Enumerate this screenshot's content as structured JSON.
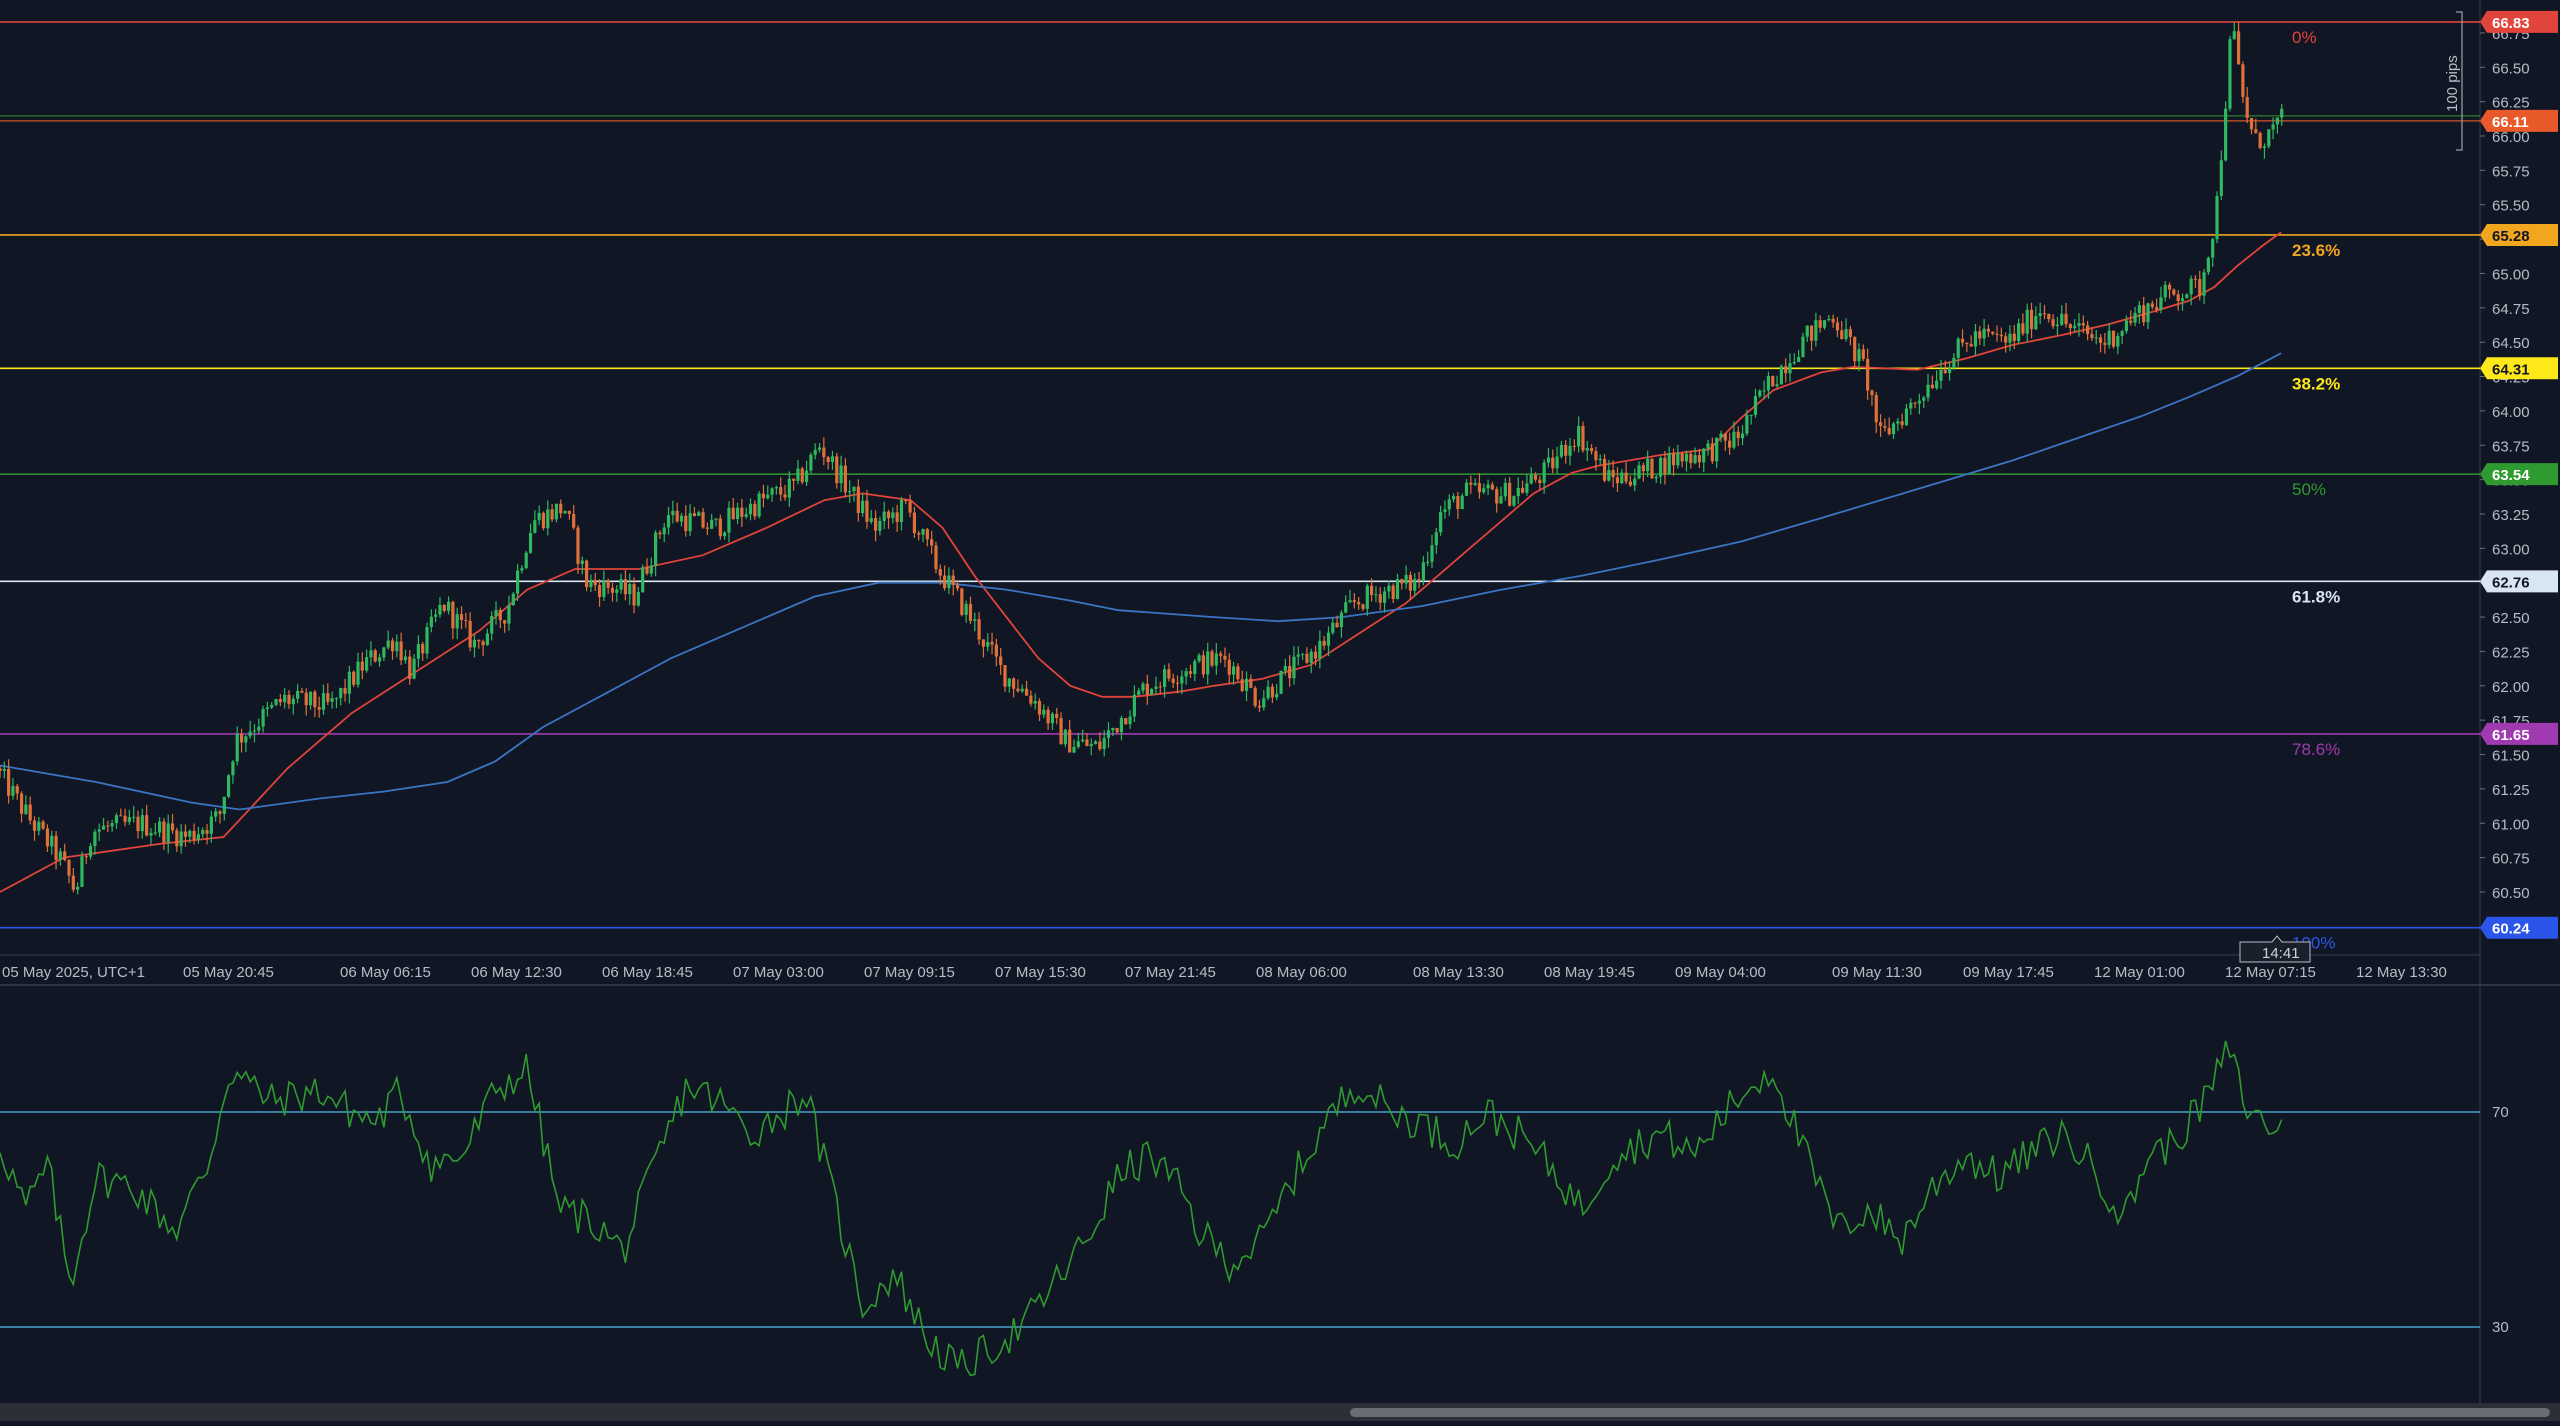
{
  "chart_data": [
    {
      "type": "candlestick",
      "title": "",
      "xlabel": "",
      "ylabel": "",
      "ylim": [
        60.0,
        66.83
      ],
      "y_ticks": [
        "60.50",
        "60.75",
        "61.00",
        "61.25",
        "61.50",
        "61.75",
        "62.00",
        "62.25",
        "62.50",
        "62.75",
        "63.00",
        "63.25",
        "63.50",
        "63.75",
        "64.00",
        "64.25",
        "64.50",
        "64.75",
        "65.00",
        "65.25",
        "65.50",
        "65.75",
        "66.00",
        "66.25",
        "66.50",
        "66.75"
      ],
      "x_ticks": [
        "05 May 2025, UTC+1",
        "05 May 20:45",
        "06 May 06:15",
        "06 May 12:30",
        "06 May 18:45",
        "07 May 03:00",
        "07 May 09:15",
        "07 May 15:30",
        "07 May 21:45",
        "08 May 06:00",
        "08 May 13:30",
        "08 May 19:45",
        "09 May 04:00",
        "09 May 11:30",
        "09 May 17:45",
        "12 May 01:00",
        "12 May 07:15",
        "12 May 13:30"
      ],
      "crosshair_time": "14:41",
      "range_marker_label": "100 pips",
      "last_price": 66.11,
      "price_path": [
        [
          0,
          61.4
        ],
        [
          10,
          61.05
        ],
        [
          20,
          60.75
        ],
        [
          25,
          60.5
        ],
        [
          30,
          60.95
        ],
        [
          45,
          61.0
        ],
        [
          60,
          60.9
        ],
        [
          70,
          61.05
        ],
        [
          75,
          61.6
        ],
        [
          90,
          61.9
        ],
        [
          105,
          61.85
        ],
        [
          115,
          62.15
        ],
        [
          125,
          62.35
        ],
        [
          130,
          62.1
        ],
        [
          140,
          62.6
        ],
        [
          150,
          62.3
        ],
        [
          160,
          62.55
        ],
        [
          168,
          63.2
        ],
        [
          178,
          63.3
        ],
        [
          185,
          62.75
        ],
        [
          195,
          62.7
        ],
        [
          200,
          62.65
        ],
        [
          210,
          63.25
        ],
        [
          225,
          63.15
        ],
        [
          240,
          63.35
        ],
        [
          250,
          63.45
        ],
        [
          258,
          63.75
        ],
        [
          265,
          63.5
        ],
        [
          275,
          63.15
        ],
        [
          285,
          63.3
        ],
        [
          295,
          62.85
        ],
        [
          305,
          62.5
        ],
        [
          315,
          62.1
        ],
        [
          325,
          61.9
        ],
        [
          335,
          61.6
        ],
        [
          345,
          61.55
        ],
        [
          350,
          61.7
        ],
        [
          360,
          62.0
        ],
        [
          375,
          62.15
        ],
        [
          385,
          62.2
        ],
        [
          395,
          61.9
        ],
        [
          405,
          62.1
        ],
        [
          415,
          62.3
        ],
        [
          425,
          62.6
        ],
        [
          435,
          62.7
        ],
        [
          445,
          62.75
        ],
        [
          452,
          63.25
        ],
        [
          460,
          63.4
        ],
        [
          475,
          63.4
        ],
        [
          485,
          63.55
        ],
        [
          495,
          63.85
        ],
        [
          505,
          63.5
        ],
        [
          515,
          63.55
        ],
        [
          525,
          63.65
        ],
        [
          535,
          63.7
        ],
        [
          545,
          63.8
        ],
        [
          555,
          64.2
        ],
        [
          565,
          64.5
        ],
        [
          575,
          64.7
        ],
        [
          585,
          64.3
        ],
        [
          590,
          63.8
        ],
        [
          600,
          64.05
        ],
        [
          610,
          64.35
        ],
        [
          620,
          64.55
        ],
        [
          630,
          64.5
        ],
        [
          640,
          64.75
        ],
        [
          650,
          64.6
        ],
        [
          660,
          64.5
        ],
        [
          670,
          64.7
        ],
        [
          680,
          64.85
        ],
        [
          690,
          64.9
        ],
        [
          695,
          65.45
        ],
        [
          700,
          66.83
        ],
        [
          703,
          66.3
        ],
        [
          707,
          65.95
        ],
        [
          711,
          66.0
        ],
        [
          715,
          66.11
        ]
      ],
      "series": [
        {
          "name": "",
          "color": "#e0443a",
          "points": [
            [
              0,
              60.5
            ],
            [
              20,
              60.75
            ],
            [
              50,
              60.85
            ],
            [
              70,
              60.9
            ],
            [
              90,
              61.4
            ],
            [
              110,
              61.8
            ],
            [
              130,
              62.1
            ],
            [
              150,
              62.4
            ],
            [
              165,
              62.7
            ],
            [
              180,
              62.85
            ],
            [
              200,
              62.85
            ],
            [
              220,
              62.95
            ],
            [
              240,
              63.15
            ],
            [
              258,
              63.35
            ],
            [
              270,
              63.4
            ],
            [
              285,
              63.35
            ],
            [
              295,
              63.15
            ],
            [
              305,
              62.8
            ],
            [
              315,
              62.5
            ],
            [
              325,
              62.2
            ],
            [
              335,
              62.0
            ],
            [
              345,
              61.92
            ],
            [
              355,
              61.92
            ],
            [
              370,
              61.96
            ],
            [
              380,
              62.0
            ],
            [
              395,
              62.05
            ],
            [
              410,
              62.15
            ],
            [
              420,
              62.3
            ],
            [
              430,
              62.45
            ],
            [
              440,
              62.6
            ],
            [
              450,
              62.8
            ],
            [
              460,
              63.0
            ],
            [
              470,
              63.2
            ],
            [
              480,
              63.4
            ],
            [
              492,
              63.55
            ],
            [
              500,
              63.6
            ],
            [
              520,
              63.68
            ],
            [
              535,
              63.72
            ],
            [
              545,
              63.95
            ],
            [
              555,
              64.15
            ],
            [
              570,
              64.28
            ],
            [
              580,
              64.32
            ],
            [
              600,
              64.3
            ],
            [
              615,
              64.38
            ],
            [
              630,
              64.48
            ],
            [
              645,
              64.55
            ],
            [
              660,
              64.63
            ],
            [
              675,
              64.73
            ],
            [
              685,
              64.8
            ],
            [
              693,
              64.9
            ],
            [
              700,
              65.05
            ],
            [
              708,
              65.2
            ],
            [
              714,
              65.3
            ]
          ]
        },
        {
          "name": "",
          "color": "#3a75c4",
          "points": [
            [
              0,
              61.42
            ],
            [
              30,
              61.3
            ],
            [
              60,
              61.15
            ],
            [
              75,
              61.1
            ],
            [
              100,
              61.18
            ],
            [
              120,
              61.23
            ],
            [
              140,
              61.3
            ],
            [
              155,
              61.45
            ],
            [
              170,
              61.7
            ],
            [
              190,
              61.95
            ],
            [
              210,
              62.2
            ],
            [
              235,
              62.45
            ],
            [
              255,
              62.65
            ],
            [
              275,
              62.75
            ],
            [
              295,
              62.75
            ],
            [
              315,
              62.7
            ],
            [
              335,
              62.62
            ],
            [
              350,
              62.55
            ],
            [
              380,
              62.5
            ],
            [
              400,
              62.47
            ],
            [
              420,
              62.5
            ],
            [
              445,
              62.58
            ],
            [
              470,
              62.7
            ],
            [
              495,
              62.8
            ],
            [
              520,
              62.92
            ],
            [
              545,
              63.05
            ],
            [
              570,
              63.22
            ],
            [
              590,
              63.36
            ],
            [
              610,
              63.5
            ],
            [
              630,
              63.64
            ],
            [
              650,
              63.8
            ],
            [
              670,
              63.96
            ],
            [
              685,
              64.1
            ],
            [
              700,
              64.25
            ],
            [
              714,
              64.42
            ]
          ]
        }
      ],
      "fibonacci": {
        "levels": [
          {
            "label": "0%",
            "price_label": "66.83",
            "value": 66.83,
            "color": "#e0443a"
          },
          {
            "label": "23.6%",
            "price_label": "65.28",
            "value": 65.28,
            "color": "#f2a61d"
          },
          {
            "label": "38.2%",
            "price_label": "64.31",
            "value": 64.31,
            "color": "#ffe81a"
          },
          {
            "label": "50%",
            "price_label": "63.54",
            "value": 63.54,
            "color": "#2f9a2f"
          },
          {
            "label": "61.8%",
            "price_label": "62.76",
            "value": 62.76,
            "color": "#d8e6f2"
          },
          {
            "label": "78.6%",
            "price_label": "61.65",
            "value": 61.65,
            "color": "#a03ab0"
          },
          {
            "label": "100%",
            "price_label": "60.24",
            "value": 60.24,
            "color": "#2a55e8"
          }
        ]
      },
      "current_price_labels": [
        {
          "label": "66.11",
          "value": 66.11,
          "color": "#e85a2a"
        }
      ]
    },
    {
      "type": "line",
      "title": "",
      "ylim": [
        0,
        100
      ],
      "y_ticks": [
        "70",
        "30"
      ],
      "reference_lines": [
        70,
        30
      ],
      "series": [
        {
          "name": "",
          "color": "#2f9a2f",
          "points": [
            [
              0,
              64
            ],
            [
              8,
              52
            ],
            [
              15,
              60
            ],
            [
              22,
              38
            ],
            [
              30,
              58
            ],
            [
              42,
              56
            ],
            [
              55,
              48
            ],
            [
              65,
              60
            ],
            [
              72,
              78
            ],
            [
              85,
              72
            ],
            [
              100,
              74
            ],
            [
              110,
              70
            ],
            [
              118,
              68
            ],
            [
              125,
              74
            ],
            [
              135,
              60
            ],
            [
              145,
              62
            ],
            [
              155,
              74
            ],
            [
              165,
              78
            ],
            [
              175,
              52
            ],
            [
              185,
              50
            ],
            [
              195,
              44
            ],
            [
              205,
              60
            ],
            [
              215,
              75
            ],
            [
              225,
              72
            ],
            [
              235,
              66
            ],
            [
              245,
              70
            ],
            [
              252,
              74
            ],
            [
              260,
              56
            ],
            [
              270,
              34
            ],
            [
              280,
              40
            ],
            [
              290,
              28
            ],
            [
              300,
              22
            ],
            [
              310,
              26
            ],
            [
              320,
              30
            ],
            [
              330,
              38
            ],
            [
              340,
              46
            ],
            [
              350,
              58
            ],
            [
              360,
              62
            ],
            [
              370,
              55
            ],
            [
              375,
              48
            ],
            [
              385,
              42
            ],
            [
              395,
              46
            ],
            [
              405,
              58
            ],
            [
              415,
              68
            ],
            [
              425,
              76
            ],
            [
              435,
              70
            ],
            [
              445,
              68
            ],
            [
              455,
              64
            ],
            [
              465,
              70
            ],
            [
              475,
              66
            ],
            [
              485,
              60
            ],
            [
              495,
              52
            ],
            [
              505,
              62
            ],
            [
              520,
              66
            ],
            [
              530,
              62
            ],
            [
              540,
              70
            ],
            [
              548,
              75
            ],
            [
              555,
              78
            ],
            [
              565,
              62
            ],
            [
              575,
              48
            ],
            [
              585,
              52
            ],
            [
              595,
              46
            ],
            [
              605,
              56
            ],
            [
              615,
              62
            ],
            [
              625,
              58
            ],
            [
              635,
              62
            ],
            [
              645,
              66
            ],
            [
              655,
              60
            ],
            [
              665,
              50
            ],
            [
              672,
              62
            ],
            [
              680,
              64
            ],
            [
              690,
              72
            ],
            [
              698,
              82
            ],
            [
              702,
              72
            ],
            [
              708,
              68
            ],
            [
              714,
              67
            ]
          ]
        }
      ]
    }
  ]
}
